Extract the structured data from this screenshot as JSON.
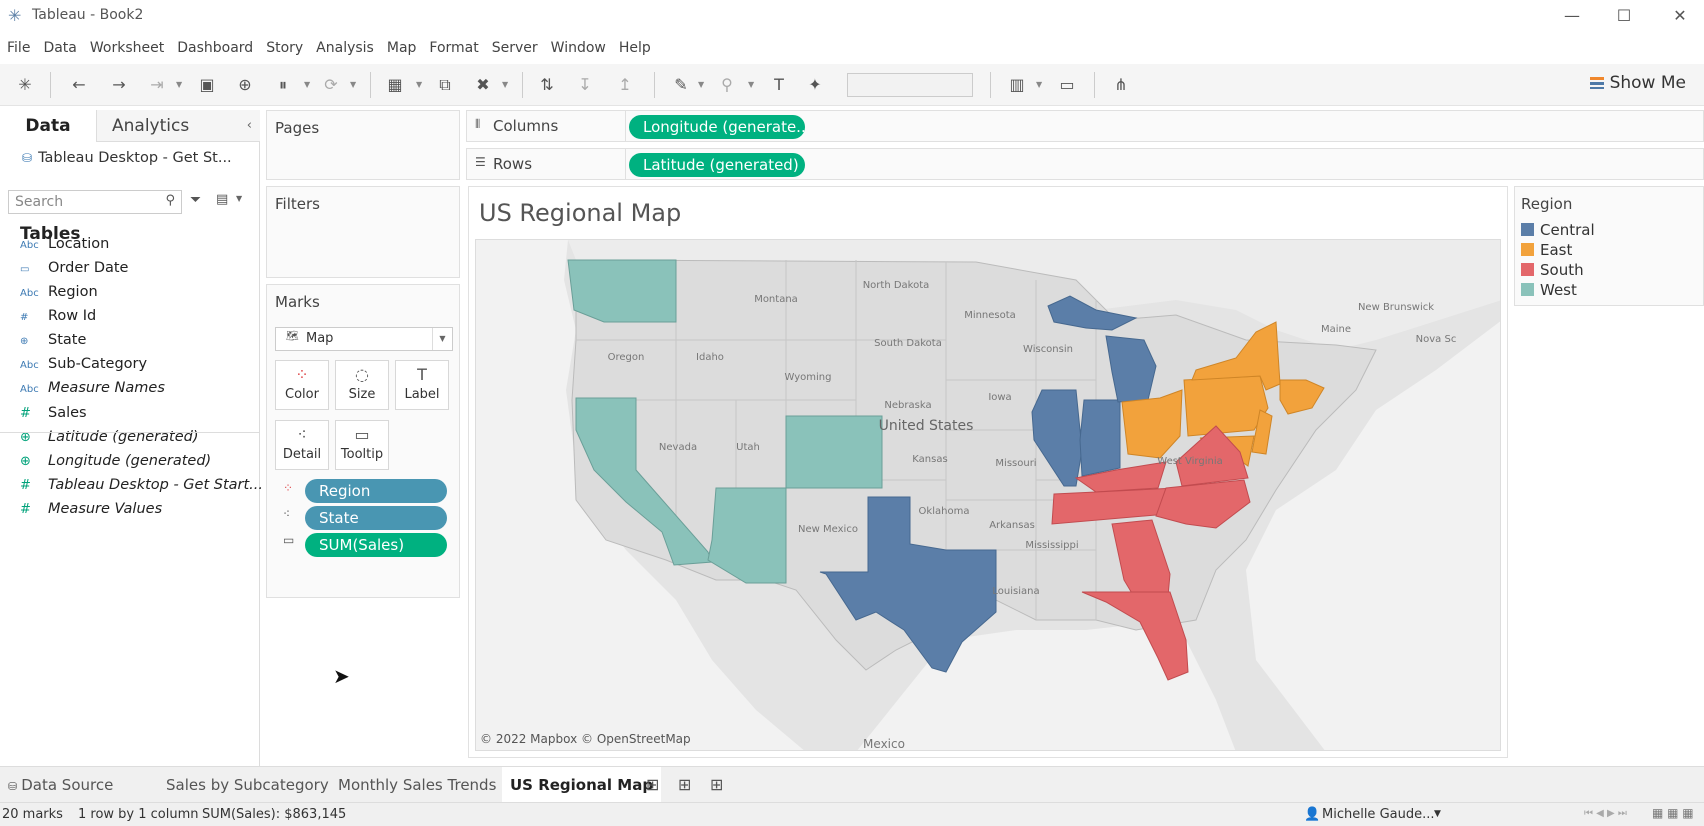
{
  "window": {
    "title": "Tableau - Book2"
  },
  "menu": [
    "File",
    "Data",
    "Worksheet",
    "Dashboard",
    "Story",
    "Analysis",
    "Map",
    "Format",
    "Server",
    "Window",
    "Help"
  ],
  "toolbar": {
    "show_me": "Show Me"
  },
  "data_pane": {
    "tabs": [
      "Data",
      "Analytics"
    ],
    "datasource": "Tableau Desktop - Get St...",
    "search_placeholder": "Search",
    "tables_label": "Tables",
    "dimensions": [
      {
        "icon": "Abc",
        "name": "Location",
        "italic": false
      },
      {
        "icon": "date",
        "name": "Order Date",
        "italic": false
      },
      {
        "icon": "Abc",
        "name": "Region",
        "italic": false
      },
      {
        "icon": "#",
        "name": "Row Id",
        "italic": false
      },
      {
        "icon": "globe",
        "name": "State",
        "italic": false
      },
      {
        "icon": "Abc",
        "name": "Sub-Category",
        "italic": false
      },
      {
        "icon": "Abc",
        "name": "Measure Names",
        "italic": true
      }
    ],
    "measures": [
      {
        "icon": "#",
        "name": "Sales",
        "italic": false
      },
      {
        "icon": "globe",
        "name": "Latitude (generated)",
        "italic": true
      },
      {
        "icon": "globe",
        "name": "Longitude (generated)",
        "italic": true
      },
      {
        "icon": "#",
        "name": "Tableau Desktop - Get Start...",
        "italic": true
      },
      {
        "icon": "#",
        "name": "Measure Values",
        "italic": true
      }
    ]
  },
  "cards": {
    "pages": "Pages",
    "filters": "Filters",
    "marks": "Marks",
    "mark_type": "Map",
    "mark_buttons": [
      "Color",
      "Size",
      "Label",
      "Detail",
      "Tooltip"
    ],
    "mark_pills": [
      "Region",
      "State",
      "SUM(Sales)"
    ]
  },
  "shelves": {
    "columns_label": "Columns",
    "rows_label": "Rows",
    "columns_pill": "Longitude (generate..",
    "rows_pill": "Latitude (generated)"
  },
  "view": {
    "title": "US Regional Map",
    "attribution": "© 2022 Mapbox © OpenStreetMap",
    "map_labels": [
      "North Dakota",
      "Montana",
      "Minnesota",
      "South Dakota",
      "Wisconsin",
      "Oregon",
      "Idaho",
      "Wyoming",
      "Iowa",
      "Nebraska",
      "United States",
      "Nevada",
      "Utah",
      "Kansas",
      "Missouri",
      "Oklahoma",
      "Arkansas",
      "New Mexico",
      "Mississippi",
      "Louisiana",
      "Maine",
      "New Brunswick",
      "Nova Sc",
      "West Virginia",
      "Mexico"
    ]
  },
  "legend": {
    "title": "Region",
    "items": [
      {
        "name": "Central",
        "color": "#5b7ea8"
      },
      {
        "name": "East",
        "color": "#f2a23c"
      },
      {
        "name": "South",
        "color": "#e3676a"
      },
      {
        "name": "West",
        "color": "#8ac2ba"
      }
    ]
  },
  "sheet_tabs": [
    "Data Source",
    "Sales by Subcategory",
    "Monthly Sales Trends",
    "US Regional Map"
  ],
  "active_tab": "US Regional Map",
  "status": {
    "marks": "20 marks",
    "rows": "1 row by 1 column",
    "sum": "SUM(Sales): $863,145",
    "user": "Michelle Gaude..."
  }
}
